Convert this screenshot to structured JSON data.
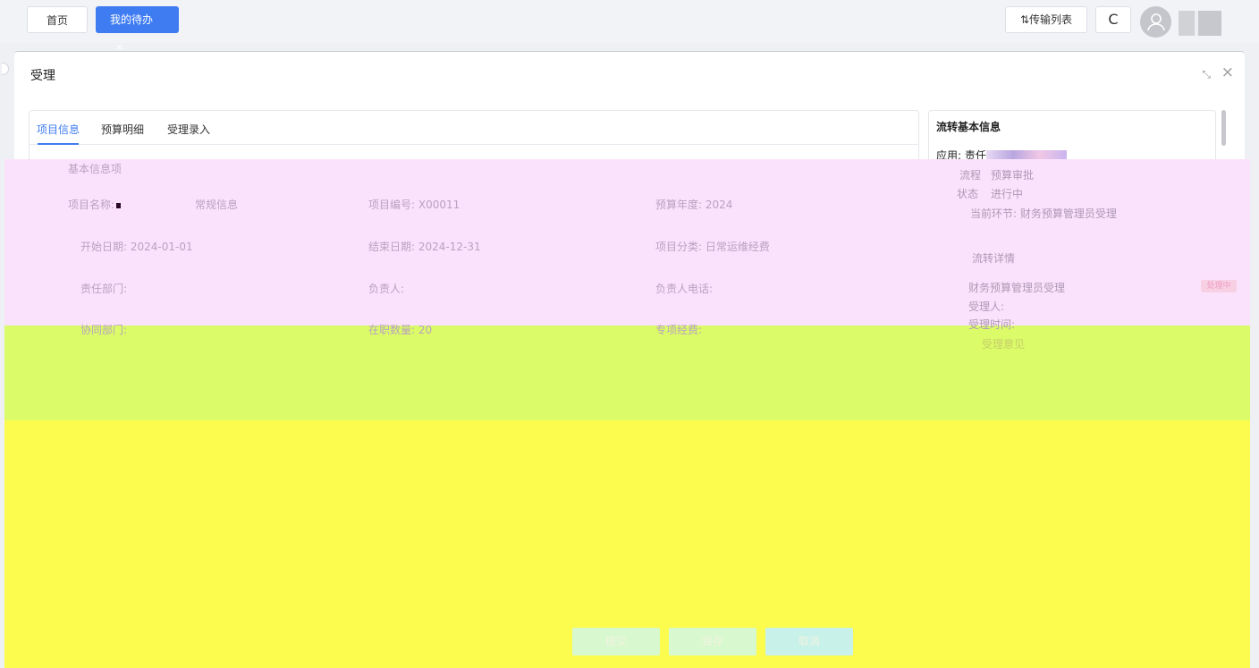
{
  "tabs": {
    "home": "首页",
    "todo": "我的待办",
    "todo_close": "×"
  },
  "toolbar": {
    "transfer_list": "⇅传输列表",
    "refresh": "C"
  },
  "dialog": {
    "title": "受理",
    "max_icon": "⤡",
    "close_icon": "×"
  },
  "panel_tabs": {
    "project_info": "项目信息",
    "budget_detail": "预算明细",
    "acceptance_entry": "受理录入"
  },
  "flow": {
    "title": "流转基本信息",
    "app_label": "应用:",
    "app_value": "责任"
  },
  "basic_info": {
    "section_title": "基本信息项",
    "project_name_label": "项目名称:",
    "project_name_value": "常规信息",
    "project_code": "项目编号: X00011",
    "budget_year": "预算年度: 2024",
    "start_date": "开始日期: 2024-01-01",
    "end_date": "结束日期: 2024-12-31",
    "project_category": "项目分类: 日常运维经费",
    "responsible_dept": "责任部门:",
    "owner": "负责人:",
    "owner_phone": "负责人电话:",
    "cooperate_dept": "协同部门:",
    "staff_count": "在职数量: 20",
    "budget_amount_label": "专项经费:"
  },
  "flow_detail": {
    "process_label": "流程",
    "process_value": "预算审批",
    "status_label": "状态",
    "status_value": "进行中",
    "current_node": "当前环节: 财务预算管理员受理",
    "detail_title": "流转详情",
    "node_name": "财务预算管理员受理",
    "badge": "处理中",
    "handler": "受理人:",
    "handle_time": "受理时间:",
    "handle_opinion": "受理意见"
  },
  "buttons": {
    "submit": "提交",
    "save": "保存",
    "cancel": "取消"
  },
  "colors": {
    "accent": "#3f7cf2",
    "page_bg": "#eef0f4"
  }
}
